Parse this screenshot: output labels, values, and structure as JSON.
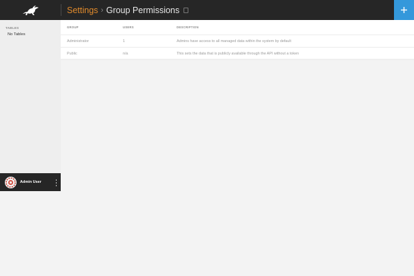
{
  "header": {
    "logo_icon": "rabbit-logo-icon",
    "breadcrumb_parent": "Settings",
    "breadcrumb_separator": "›",
    "breadcrumb_current": "Group Permissions",
    "bookmark_icon": "bookmark-icon",
    "add_button_label": "+",
    "add_button_color": "#3498db",
    "accent_color": "#e08a2c"
  },
  "sidebar": {
    "section_heading": "TABLES",
    "empty_text": "No Tables",
    "user": {
      "avatar_icon": "avatar",
      "name": "Admin User",
      "menu_icon": "more-vertical-icon"
    }
  },
  "table": {
    "columns": [
      "GROUP",
      "USERS",
      "DESCRIPTION"
    ],
    "rows": [
      {
        "group": "Administrator",
        "users": "1",
        "description": "Admins have access to all managed data within the system by default"
      },
      {
        "group": "Public",
        "users": "n/a",
        "description": "This sets the data that is publicly available through the API without a token"
      }
    ]
  }
}
